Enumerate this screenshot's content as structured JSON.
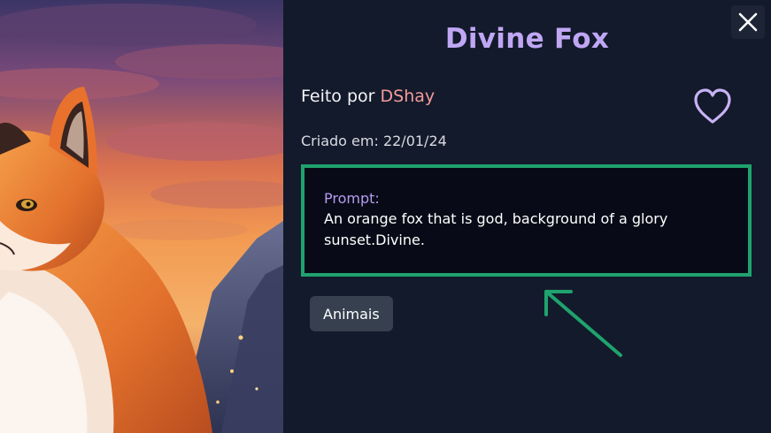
{
  "artwork": {
    "title": "Divine Fox",
    "author_prefix": "Feito por ",
    "author_name": "DShay",
    "created_label": "Criado em: 22/01/24",
    "prompt_label": "Prompt:",
    "prompt_text": "An orange fox that is god, background of a glory sunset.Divine.",
    "tags": [
      "Animais"
    ]
  },
  "icons": {
    "close": "close-icon",
    "like": "heart-outline-icon",
    "annotation": "arrow-annotation-icon"
  },
  "colors": {
    "panel_background": "#131a2b",
    "title": "#c0a7f4",
    "author_name": "#f59b9b",
    "prompt_label": "#b69bf0",
    "highlight_border": "#1fa36e",
    "annotation_arrow": "#1fa36e",
    "heart_outline": "#c7b3f5"
  }
}
